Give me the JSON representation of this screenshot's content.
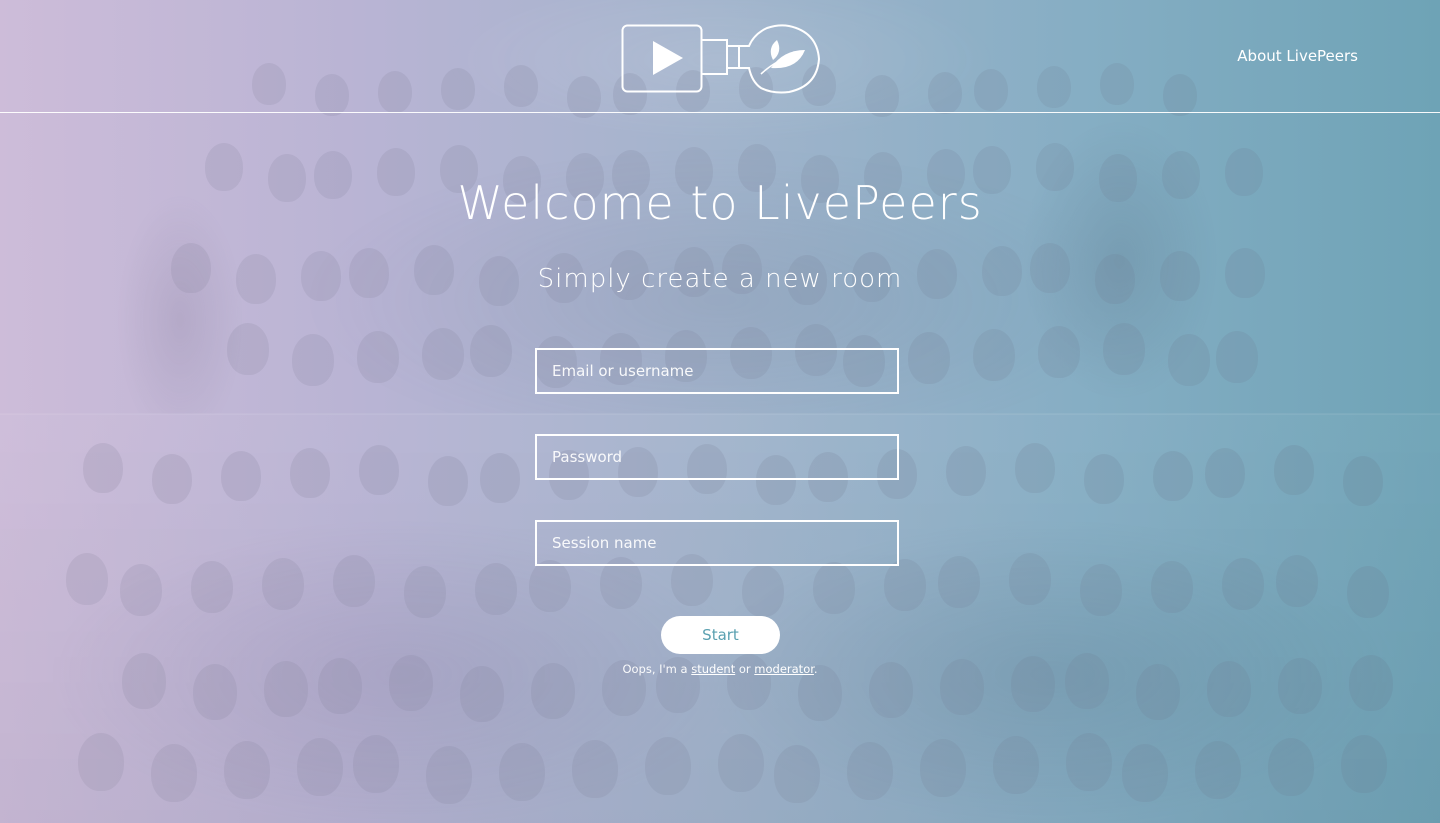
{
  "header": {
    "logo_name": "LivePeers logo",
    "about_label": "About LivePeers"
  },
  "main": {
    "title": "Welcome to LivePeers",
    "subtitle": "Simply create a new room",
    "email_placeholder": "Email or username",
    "password_placeholder": "Password",
    "session_placeholder": "Session name",
    "start_label": "Start",
    "role_prefix": "Oops, I'm a",
    "role_student": "student",
    "role_or": "or",
    "role_moderator": "moderator",
    "role_suffix": "."
  },
  "colors": {
    "gradient_left": "#cdbcd9",
    "gradient_right": "#6ea3b6",
    "button_text": "#5aa0b0",
    "foreground": "#ffffff"
  },
  "icons": {
    "logo_left": "video-play-icon",
    "logo_right": "leaf-bulb-icon"
  }
}
